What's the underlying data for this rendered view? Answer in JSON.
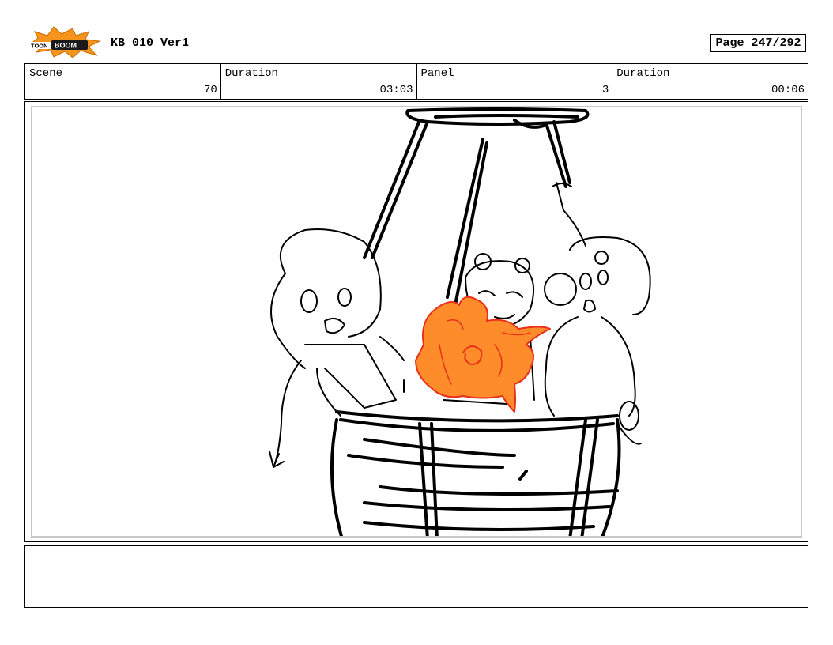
{
  "header": {
    "logo_text": "TOON BOOM",
    "project_title": "KB 010 Ver1",
    "page_label": "Page 247/292"
  },
  "info": {
    "scene_label": "Scene",
    "scene_value": "70",
    "scene_duration_label": "Duration",
    "scene_duration_value": "03:03",
    "panel_label": "Panel",
    "panel_value": "3",
    "panel_duration_label": "Duration",
    "panel_duration_value": "00:06"
  },
  "notes": {
    "text": ""
  },
  "colors": {
    "fire_fill": "#ff8c2a",
    "fire_stroke": "#e8301a",
    "logo_orange": "#f7941d",
    "frame_gray": "#c8c8c8"
  }
}
